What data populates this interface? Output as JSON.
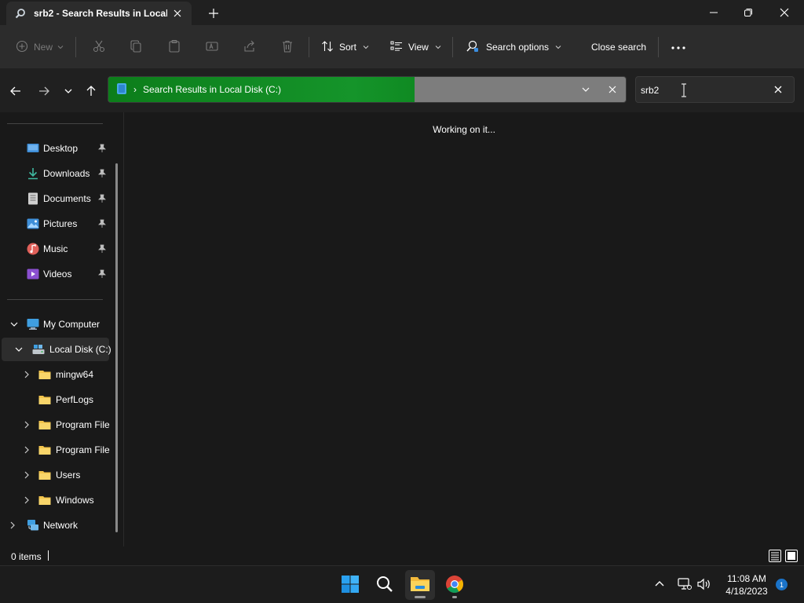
{
  "window": {
    "tab_title": "srb2 - Search Results in Local",
    "controls": [
      "minimize",
      "maximize",
      "close"
    ]
  },
  "toolbar": {
    "new_label": "New",
    "sort_label": "Sort",
    "view_label": "View",
    "search_options_label": "Search options",
    "close_search_label": "Close search"
  },
  "address": {
    "breadcrumb_sep": "›",
    "path": "Search Results in Local Disk (C:)"
  },
  "search": {
    "value": "srb2"
  },
  "sidebar": {
    "quick_access": [
      {
        "label": "Desktop",
        "icon": "desktop-icon",
        "color": "#3f8fd8"
      },
      {
        "label": "Downloads",
        "icon": "download-icon",
        "color": "#3fb8a0"
      },
      {
        "label": "Documents",
        "icon": "document-icon",
        "color": "#c9c9c9"
      },
      {
        "label": "Pictures",
        "icon": "picture-icon",
        "color": "#3f8fd8"
      },
      {
        "label": "Music",
        "icon": "music-icon",
        "color": "#e0605a"
      },
      {
        "label": "Videos",
        "icon": "video-icon",
        "color": "#8a4fd0"
      }
    ],
    "my_computer": "My Computer",
    "local_disk": "Local Disk (C:)",
    "folders": [
      {
        "label": "mingw64",
        "expandable": true
      },
      {
        "label": "PerfLogs",
        "expandable": false
      },
      {
        "label": "Program File",
        "expandable": true
      },
      {
        "label": "Program File",
        "expandable": true
      },
      {
        "label": "Users",
        "expandable": true
      },
      {
        "label": "Windows",
        "expandable": true
      }
    ],
    "network": "Network"
  },
  "main": {
    "status_message": "Working on it..."
  },
  "statusbar": {
    "count": "0 items"
  },
  "taskbar": {
    "time": "11:08 AM",
    "date": "4/18/2023",
    "notification_count": "1"
  },
  "colors": {
    "accent_green": "#15942a",
    "folder_yellow": "#f2c44b",
    "accent_blue": "#1a73c9"
  }
}
